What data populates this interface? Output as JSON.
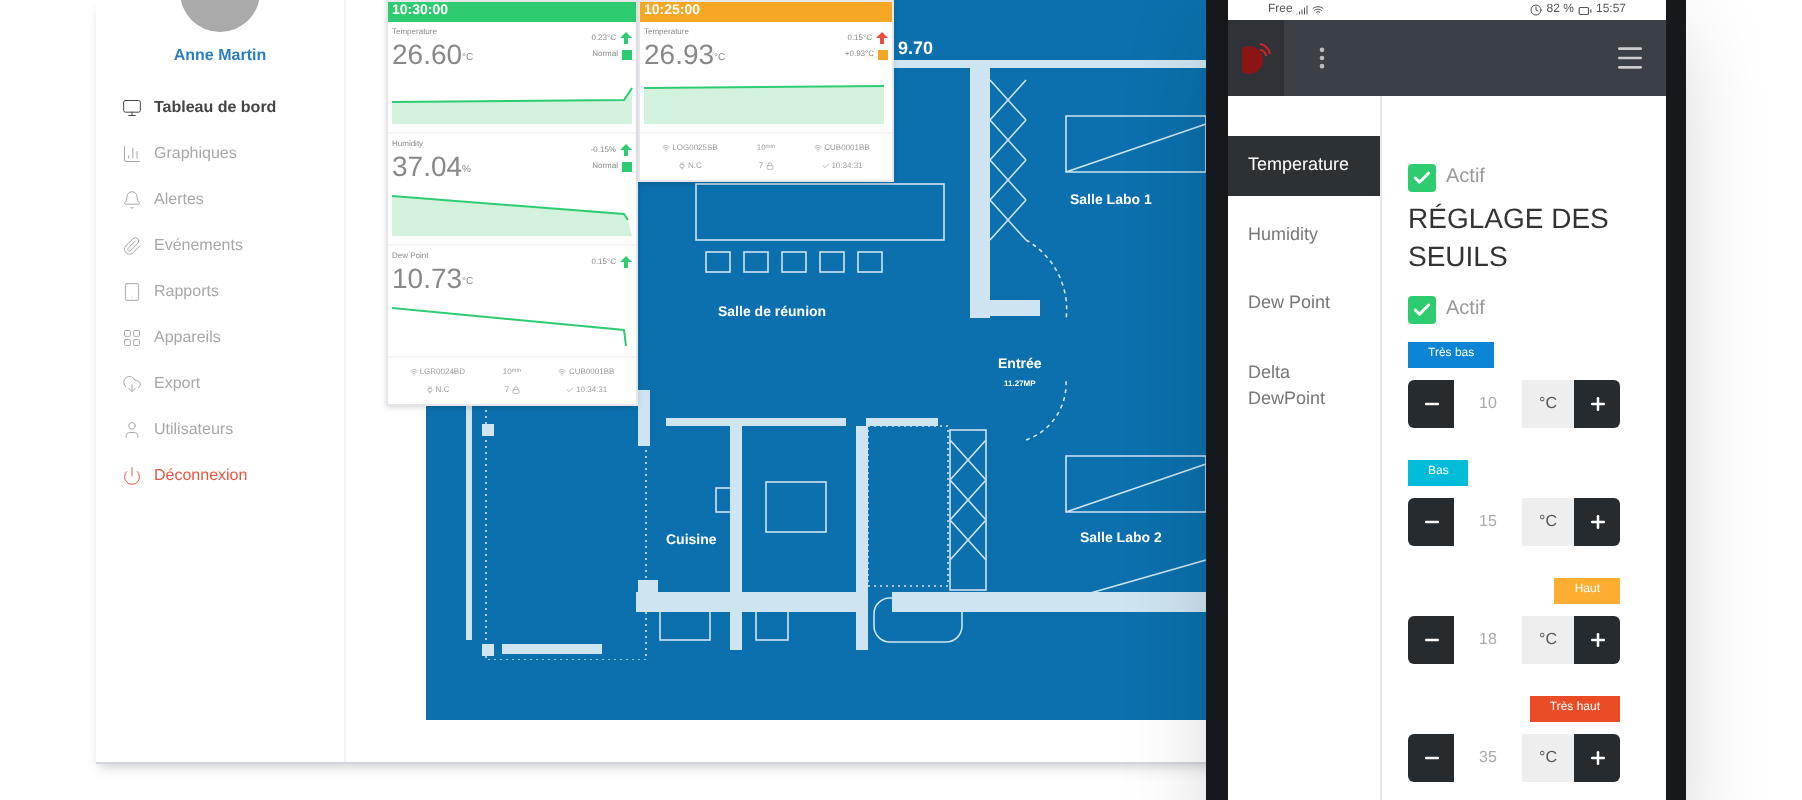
{
  "sidebar": {
    "user_name": "Anne Martin",
    "items": [
      {
        "label": "Tableau de bord",
        "selected": true,
        "kind": "link"
      },
      {
        "label": "Graphiques",
        "selected": false,
        "kind": "link"
      },
      {
        "label": "Alertes",
        "selected": false,
        "kind": "link"
      },
      {
        "label": "Evénements",
        "selected": false,
        "kind": "link"
      },
      {
        "label": "Rapports",
        "selected": false,
        "kind": "link"
      },
      {
        "label": "Appareils",
        "selected": false,
        "kind": "link"
      },
      {
        "label": "Export",
        "selected": false,
        "kind": "link"
      },
      {
        "label": "Utilisateurs",
        "selected": false,
        "kind": "link"
      },
      {
        "label": "Déconnexion",
        "selected": false,
        "kind": "logout"
      }
    ]
  },
  "sensor_cards": [
    {
      "time": "10:30:00",
      "color": "#2ecc71",
      "readings": [
        {
          "label": "Temperature",
          "value": "26.60",
          "unit": "°C",
          "trend": {
            "label": "0.23°C",
            "color": "#2ecc71"
          },
          "status": {
            "label": "Normal",
            "color": "#2ecc71"
          },
          "kind": "area"
        },
        {
          "label": "Humidity",
          "value": "37.04",
          "unit": "%",
          "trend": {
            "label": "-0.15%",
            "color": "#2ecc71"
          },
          "status": {
            "label": "Normal",
            "color": "#2ecc71"
          },
          "kind": "area"
        },
        {
          "label": "Dew Point",
          "value": "10.73",
          "unit": "°C",
          "trend": {
            "label": "0.15°C",
            "color": "#2ecc71"
          },
          "kind": "line"
        }
      ],
      "footer": {
        "logger": "LGR0024BD",
        "interval": "10",
        "interval_unit": "min",
        "hub": "CUB0001BB",
        "power": "N.C",
        "count": "7",
        "checked_time": "10:34:31"
      }
    },
    {
      "time": "10:25:00",
      "color": "#f5a623",
      "readings": [
        {
          "label": "Temperature",
          "value": "26.93",
          "unit": "°C",
          "trend": {
            "label": "0.15°C",
            "color": "#e74c3c"
          },
          "status": {
            "label": "+0.93°C",
            "color": "#f5a623"
          },
          "kind": "area"
        }
      ],
      "footer": {
        "logger": "LOG0025SB",
        "interval": "10",
        "interval_unit": "min",
        "hub": "CUB0001BB",
        "power": "N.C",
        "count": "7",
        "checked_time": "10:34:31"
      }
    }
  ],
  "floor_plan": {
    "labels": [
      {
        "label": "9.70"
      },
      {
        "label": "Salle Labo 1"
      },
      {
        "label": "Salle de réunion"
      },
      {
        "label": "Entrée",
        "sublabel": "11.27MP"
      },
      {
        "label": "Cuisine"
      },
      {
        "label": "Salle Labo 2"
      }
    ]
  },
  "phone": {
    "status_bar": {
      "carrier": "Free",
      "battery": "82 %",
      "time": "15:57"
    },
    "menu": [
      {
        "label": "Temperature",
        "selected": true
      },
      {
        "label": "Humidity",
        "selected": false
      },
      {
        "label": "Dew Point",
        "selected": false
      },
      {
        "label": "Delta DewPoint",
        "selected": false
      }
    ],
    "active_1": {
      "label": "Actif",
      "checked": true
    },
    "title": "RÉGLAGE DES SEUILS",
    "active_2": {
      "label": "Actif",
      "checked": true
    },
    "thresholds": [
      {
        "label": "Très bas",
        "color": "#0b84d6",
        "kind": "low",
        "value": "10",
        "unit": "°C"
      },
      {
        "label": "Bas",
        "color": "#00bcd9",
        "kind": "low",
        "value": "15",
        "unit": "°C"
      },
      {
        "label": "Haut",
        "color": "#fbae32",
        "kind": "high",
        "value": "18",
        "unit": "°C"
      },
      {
        "label": "Très haut",
        "color": "#ea4d26",
        "kind": "high",
        "value": "35",
        "unit": "°C"
      }
    ]
  }
}
